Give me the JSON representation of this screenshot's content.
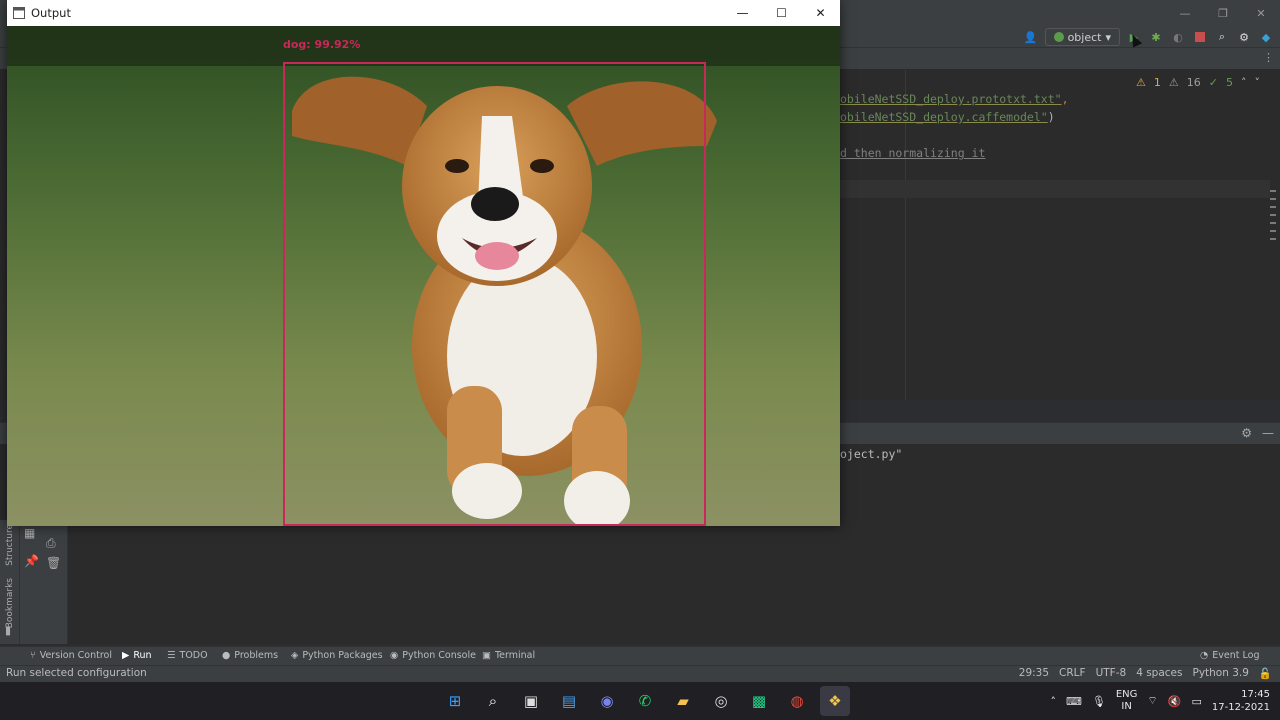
{
  "output_window": {
    "title": "Output",
    "detection": {
      "label": "dog: 99.92%",
      "color": "#c8285a"
    },
    "controls": {
      "minimize": "—",
      "maximize": "☐",
      "close": "✕"
    }
  },
  "ide": {
    "run_config": {
      "name": "object"
    },
    "inspections": {
      "warnings": "1",
      "weak_warnings": "16",
      "ok": "5"
    },
    "code_lines": [
      {
        "text": "obileNetSSD_deploy.prototxt.txt\"",
        "suffix": ","
      },
      {
        "text": "obileNetSSD_deploy.caffemodel\"",
        "suffix": ")"
      },
      {
        "text": "d then normalizing it",
        "suffix": ""
      }
    ],
    "console_line": "oject.py\"",
    "tool_windows": [
      "Version Control",
      "Run",
      "TODO",
      "Problems",
      "Python Packages",
      "Python Console",
      "Terminal"
    ],
    "event_log": "Event Log",
    "status_message": "Run selected configuration",
    "status_right": [
      "29:35",
      "CRLF",
      "UTF-8",
      "4 spaces",
      "Python 3.9"
    ],
    "side_labels": {
      "structure": "Structure",
      "bookmarks": "Bookmarks"
    }
  },
  "taskbar": {
    "apps": [
      "windows-start",
      "search",
      "task-view",
      "widgets",
      "teams-chat",
      "whatsapp",
      "file-explorer",
      "obs",
      "pycharm",
      "chrome",
      "python"
    ],
    "lang_line1": "ENG",
    "lang_line2": "IN",
    "time": "17:45",
    "date": "17-12-2021"
  },
  "colors": {
    "ide_bg": "#2b2b2b",
    "panel": "#3c3f41",
    "taskbar": "#1f1f24",
    "bbox": "#c8285a"
  }
}
